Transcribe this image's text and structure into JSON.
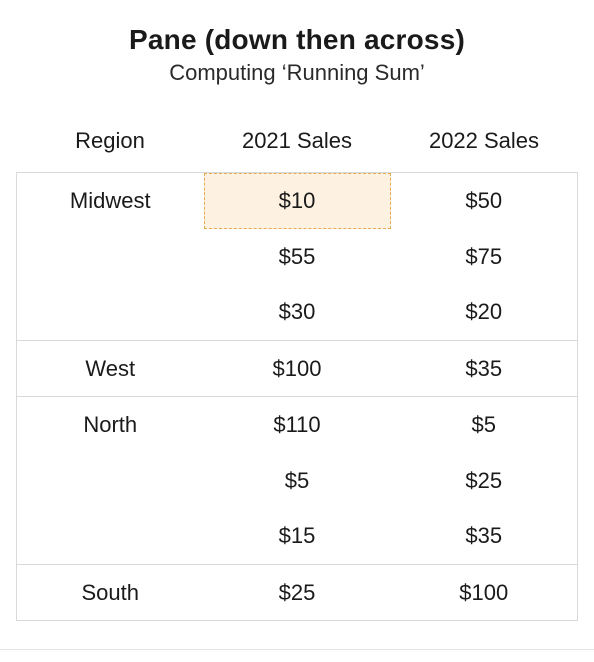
{
  "title": "Pane (down then across)",
  "subtitle": "Computing ‘Running Sum’",
  "columns": {
    "region": "Region",
    "a": "2021 Sales",
    "b": "2022 Sales"
  },
  "groups": [
    {
      "region": "Midwest",
      "rows": [
        {
          "a": "$10",
          "b": "$50",
          "highlight_a": true
        },
        {
          "a": "$55",
          "b": "$75"
        },
        {
          "a": "$30",
          "b": "$20"
        }
      ]
    },
    {
      "region": "West",
      "rows": [
        {
          "a": "$100",
          "b": "$35"
        }
      ]
    },
    {
      "region": "North",
      "rows": [
        {
          "a": "$110",
          "b": "$5"
        },
        {
          "a": "$5",
          "b": "$25"
        },
        {
          "a": "$15",
          "b": "$35"
        }
      ]
    },
    {
      "region": "South",
      "rows": [
        {
          "a": "$25",
          "b": "$100"
        }
      ]
    }
  ],
  "chart_data": {
    "type": "table",
    "title": "Pane (down then across) — Computing Running Sum",
    "columns": [
      "Region",
      "2021 Sales",
      "2022 Sales"
    ],
    "rows": [
      [
        "Midwest",
        10,
        50
      ],
      [
        "Midwest",
        55,
        75
      ],
      [
        "Midwest",
        30,
        20
      ],
      [
        "West",
        100,
        35
      ],
      [
        "North",
        110,
        5
      ],
      [
        "North",
        5,
        25
      ],
      [
        "North",
        15,
        35
      ],
      [
        "South",
        25,
        100
      ]
    ],
    "highlighted_cell": {
      "row": 0,
      "column": "2021 Sales"
    }
  }
}
